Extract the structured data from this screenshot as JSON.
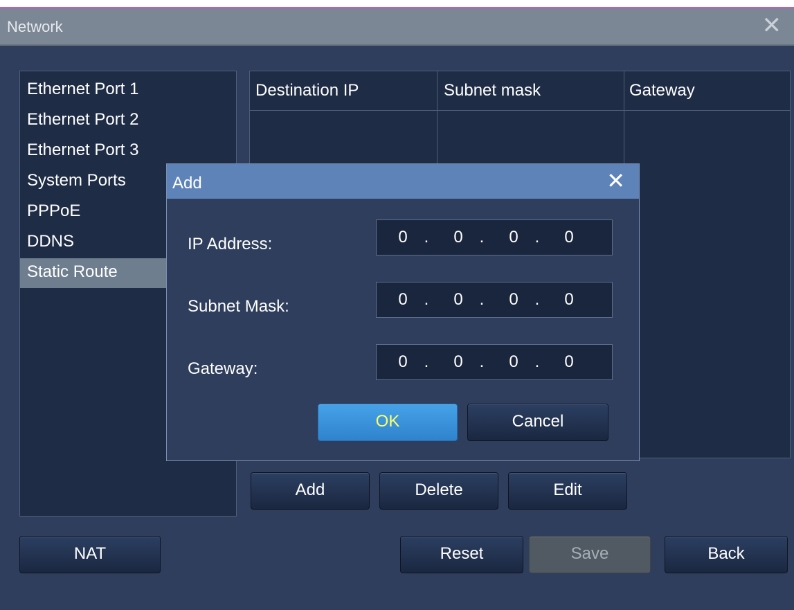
{
  "window": {
    "title": "Network",
    "close_symbol": "✕"
  },
  "sidebar": {
    "items": [
      {
        "label": "Ethernet Port 1"
      },
      {
        "label": "Ethernet Port 2"
      },
      {
        "label": "Ethernet Port 3"
      },
      {
        "label": "System Ports"
      },
      {
        "label": "PPPoE"
      },
      {
        "label": "DDNS"
      },
      {
        "label": "Static Route",
        "selected": true
      }
    ]
  },
  "route_table": {
    "columns": [
      "Destination IP",
      "Subnet mask",
      "Gateway"
    ],
    "rows": []
  },
  "route_actions": {
    "add": "Add",
    "delete": "Delete",
    "edit": "Edit"
  },
  "footer": {
    "nat": "NAT",
    "reset": "Reset",
    "save": "Save",
    "back": "Back",
    "save_disabled": true
  },
  "dialog": {
    "title": "Add",
    "close_symbol": "✕",
    "ip_address": {
      "label": "IP Address:",
      "octets": [
        "0",
        "0",
        "0",
        "0"
      ]
    },
    "subnet_mask": {
      "label": "Subnet Mask:",
      "octets": [
        "0",
        "0",
        "0",
        "0"
      ]
    },
    "gateway": {
      "label": "Gateway:",
      "octets": [
        "0",
        "0",
        "0",
        "0"
      ]
    },
    "ok": "OK",
    "cancel": "Cancel"
  },
  "colors": {
    "window_bg": "#2e3e5c",
    "titlebar": "#7b8794",
    "dialog_title": "#5d83b9",
    "ok_button": "#3b93dc",
    "ok_text": "#ffff66",
    "selected_item": "#6e7e8e"
  }
}
